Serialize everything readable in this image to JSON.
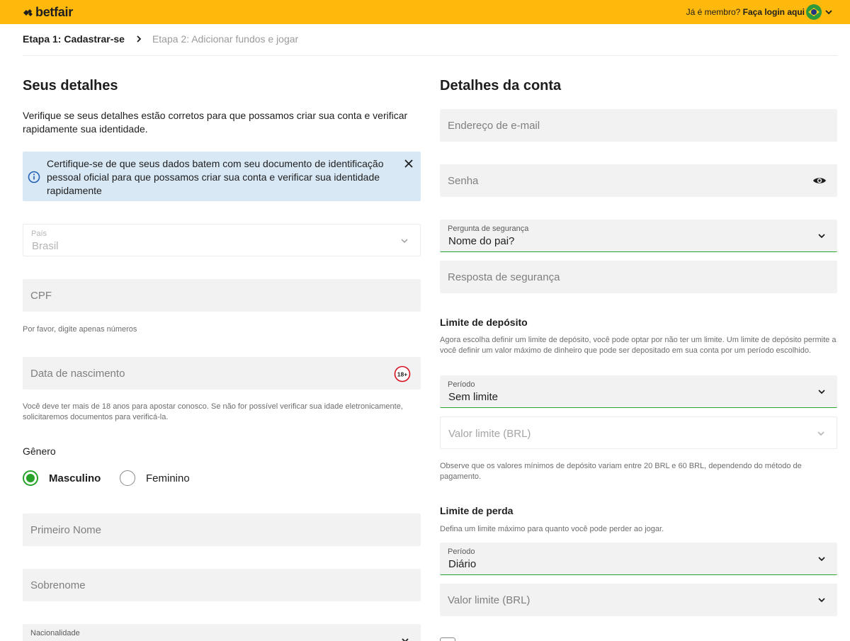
{
  "header": {
    "logo_text": "betfair",
    "member_prompt": "Já é membro?",
    "login_link": "Faça login aqui"
  },
  "steps": {
    "step1": "Etapa 1: Cadastrar-se",
    "step2": "Etapa 2: Adicionar fundos e jogar"
  },
  "details": {
    "title": "Seus detalhes",
    "intro": "Verifique se seus detalhes estão corretos para que possamos criar sua conta e verificar rapidamente sua identidade.",
    "alert": "Certifique-se de que seus dados batem com seu documento de identificação pessoal oficial para que possamos criar sua conta e verificar sua identidade rapidamente",
    "country_label": "País",
    "country_value": "Brasil",
    "cpf_placeholder": "CPF",
    "cpf_help": "Por favor, digite apenas números",
    "dob_placeholder": "Data de nascimento",
    "age_badge": "18+",
    "dob_help": "Você deve ter mais de 18 anos para apostar conosco. Se não for possível verificar sua idade eletronicamente, solicitaremos documentos para verificá-la.",
    "gender_label": "Gênero",
    "gender_male": "Masculino",
    "gender_female": "Feminino",
    "first_name_placeholder": "Primeiro Nome",
    "last_name_placeholder": "Sobrenome",
    "nationality_label": "Nacionalidade"
  },
  "account": {
    "title": "Detalhes da conta",
    "email_placeholder": "Endereço de e-mail",
    "password_placeholder": "Senha",
    "security_question_label": "Pergunta de segurança",
    "security_question_value": "Nome do pai?",
    "security_answer_placeholder": "Resposta de segurança",
    "deposit_title": "Limite de depósito",
    "deposit_desc": "Agora escolha definir um limite de depósito, você pode optar por não ter um limite. Um limite de depósito permite a você definir um valor máximo de dinheiro que pode ser depositado em sua conta por um período escolhido.",
    "deposit_period_label": "Período",
    "deposit_period_value": "Sem limite",
    "deposit_amount_placeholder": "Valor limite (BRL)",
    "deposit_note": "Observe que os valores mínimos de depósito variam entre 20 BRL e 60 BRL, dependendo do método de pagamento.",
    "loss_title": "Limite de perda",
    "loss_desc": "Defina um limite máximo para quanto você pode perder ao jogar.",
    "loss_period_label": "Período",
    "loss_period_value": "Diário",
    "loss_amount_placeholder": "Valor limite (BRL)"
  },
  "colors": {
    "brand": "#ffb80c",
    "accent_green": "#27a32a",
    "alert_bg": "#d9e8f5",
    "age_badge": "#d4121d"
  },
  "icons": {
    "logo": "betfair-logo-icon",
    "flag": "brazil-flag-icon",
    "info": "info-icon",
    "close": "close-icon",
    "eye": "eye-icon",
    "chevron": "chevron-down-icon"
  }
}
